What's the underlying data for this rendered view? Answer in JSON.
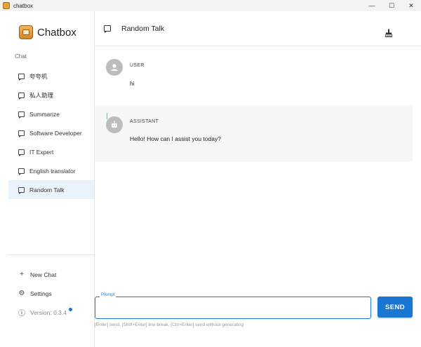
{
  "window": {
    "title": "chatbox",
    "controls": {
      "minimize": "—",
      "maximize": "☐",
      "close": "✕"
    }
  },
  "sidebar": {
    "brand": "Chatbox",
    "section_label": "Chat",
    "items": [
      {
        "label": "夸夸机",
        "icon": "chat-bubble-icon",
        "active": false
      },
      {
        "label": "私人助理",
        "icon": "chat-bubble-icon",
        "active": false
      },
      {
        "label": "Summarize",
        "icon": "chat-bubble-icon",
        "active": false
      },
      {
        "label": "Software Developer",
        "icon": "chat-bubble-icon",
        "active": false
      },
      {
        "label": "IT Expert",
        "icon": "chat-bubble-icon",
        "active": false
      },
      {
        "label": "English translator",
        "icon": "chat-bubble-icon",
        "active": false
      },
      {
        "label": "Random Talk",
        "icon": "chat-bubble-icon",
        "active": true
      }
    ],
    "bottom": {
      "new_chat": "New Chat",
      "settings": "Settings",
      "version": "Version: 0.3.4"
    }
  },
  "header": {
    "title": "Random Talk",
    "clean_icon": "broom-icon"
  },
  "messages": [
    {
      "role": "USER",
      "content": "hi"
    },
    {
      "role": "ASSISTANT",
      "content": "Hello! How can I assist you today?"
    }
  ],
  "composer": {
    "label": "Prompt",
    "value": "",
    "send_label": "SEND",
    "hint": "[Enter] send, [Shift+Enter] line break, [Ctrl+Enter] send without generating"
  },
  "colors": {
    "accent": "#1976d2",
    "active_item_bg": "#eaf2fb",
    "assistant_bg": "#f7f7f7",
    "avatar_bg": "#bdbdbd"
  }
}
